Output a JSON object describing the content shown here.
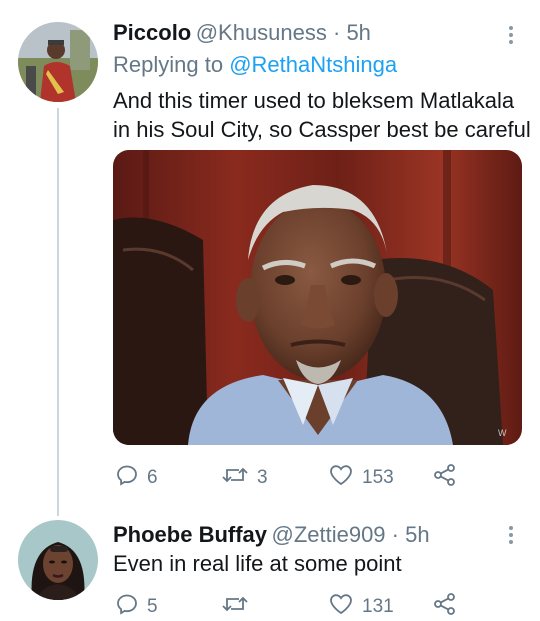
{
  "tweets": [
    {
      "display_name": "Piccolo",
      "handle": "@Khusuness",
      "time": " · 5h",
      "reply_prefix": "Replying to ",
      "reply_to": "@RethaNtshinga",
      "text_lines": [
        "And this timer used to bleksem Matlakala",
        "in his Soul City, so Cassper best be careful"
      ],
      "replies": "6",
      "retweets": "3",
      "likes": "153",
      "media_watermark": "W"
    },
    {
      "display_name": "Phoebe Buffay",
      "handle": "@Zettie909",
      "time": " · 5h",
      "text_lines": [
        "Even in real life at some point"
      ],
      "replies": "5",
      "retweets": "",
      "likes": "131"
    }
  ],
  "icons": {
    "reply": "reply-icon",
    "retweet": "retweet-icon",
    "like": "heart-icon",
    "share": "share-icon",
    "more": "more-vertical-icon"
  },
  "colors": {
    "text": "#14171a",
    "secondary": "#657786",
    "link": "#1da1f2",
    "thread": "#ccd6dd"
  }
}
